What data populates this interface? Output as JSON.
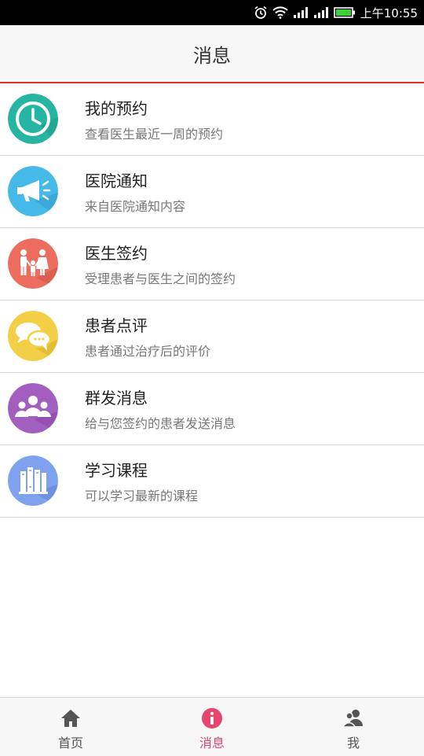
{
  "status_bar": {
    "time": "上午10:55"
  },
  "header": {
    "title": "消息"
  },
  "items": [
    {
      "title": "我的预约",
      "subtitle": "查看医生最近一周的预约",
      "icon": "clock-icon",
      "color": "#26b5a2"
    },
    {
      "title": "医院通知",
      "subtitle": "来自医院通知内容",
      "icon": "megaphone-icon",
      "color": "#45b9e8"
    },
    {
      "title": "医生签约",
      "subtitle": "受理患者与医生之间的签约",
      "icon": "family-icon",
      "color": "#ec6d5d"
    },
    {
      "title": "患者点评",
      "subtitle": "患者通过治疗后的评价",
      "icon": "chat-bubbles-icon",
      "color": "#f3cf45"
    },
    {
      "title": "群发消息",
      "subtitle": "给与您签约的患者发送消息",
      "icon": "group-icon",
      "color": "#a25fc0"
    },
    {
      "title": "学习课程",
      "subtitle": "可以学习最新的课程",
      "icon": "books-icon",
      "color": "#7fa2ee"
    }
  ],
  "tabbar": {
    "tabs": [
      {
        "label": "首页",
        "icon": "home-icon",
        "active": false
      },
      {
        "label": "消息",
        "icon": "info-icon",
        "active": true
      },
      {
        "label": "我",
        "icon": "users-icon",
        "active": false
      }
    ],
    "active_color": "#e6456e"
  },
  "accent_color": "#d9342b"
}
